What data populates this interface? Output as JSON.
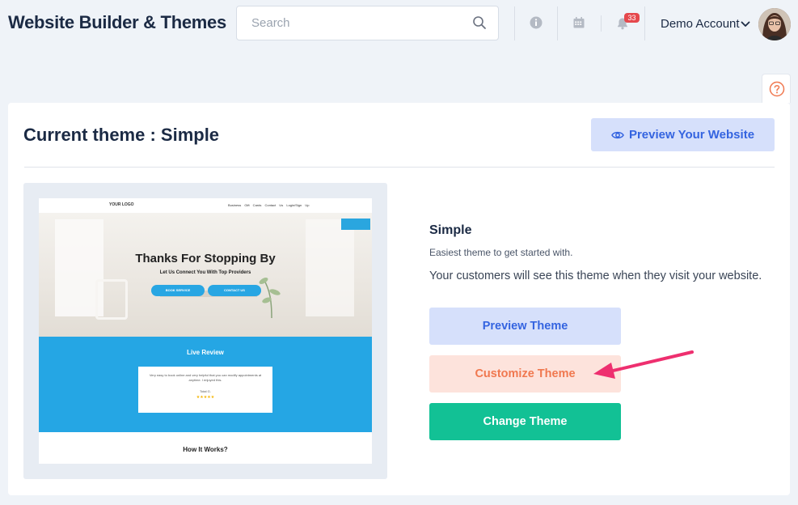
{
  "header": {
    "title": "Website Builder & Themes",
    "search_placeholder": "Search",
    "notification_count": "33",
    "account_name": "Demo Account"
  },
  "card": {
    "title": "Current theme : Simple",
    "preview_site_label": "Preview Your Website"
  },
  "thumbnail": {
    "logo": "YOUR LOGO",
    "nav_links": "Business Gift Cards Contact Us Login/Sign Up",
    "hero_title": "Thanks For Stopping By",
    "hero_subtitle": "Let Us Connect You With Top Providers",
    "btn_book": "BOOK SERVICE",
    "btn_contact": "CONTACT US",
    "review_title": "Live Review",
    "review_text": "Very easy to book online and very helpful that you can modify appointments at anytime. I enjoyed this.",
    "review_name": "Total G.",
    "review_stars": "★★★★★",
    "how_title": "How It Works?"
  },
  "theme": {
    "name": "Simple",
    "subtitle": "Easiest theme to get started with.",
    "description": "Your customers will see this theme when they visit your website.",
    "preview_label": "Preview Theme",
    "customize_label": "Customize Theme",
    "change_label": "Change Theme"
  },
  "colors": {
    "primary": "#3464e0",
    "customize": "#f0784f",
    "change": "#12c195",
    "arrow": "#ee2f6f",
    "badge": "#e5484d"
  },
  "icons": [
    "search-icon",
    "info-icon",
    "calendar-icon",
    "bell-icon",
    "chevron-down-icon",
    "help-icon",
    "eye-icon"
  ]
}
